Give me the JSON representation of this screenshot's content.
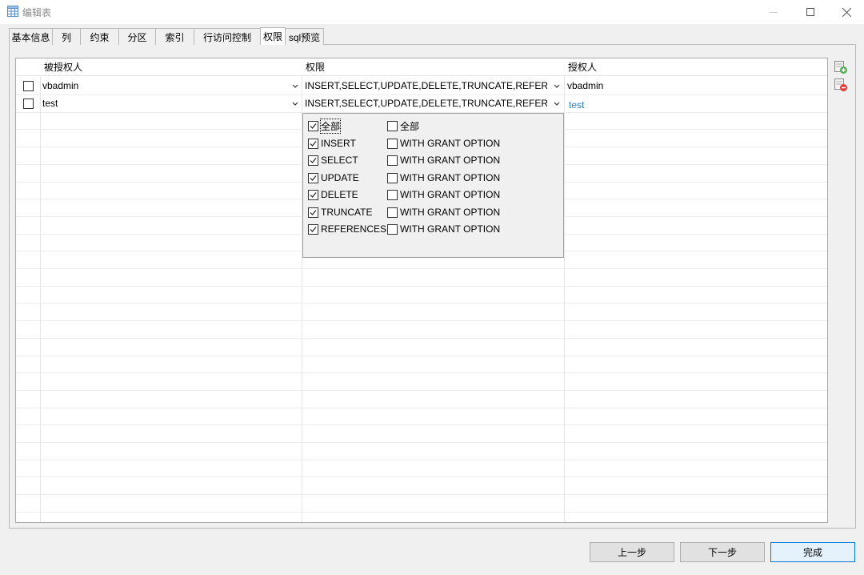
{
  "window": {
    "title": "编辑表",
    "icon": "table-icon"
  },
  "tabs": [
    {
      "label": "基本信息"
    },
    {
      "label": "列"
    },
    {
      "label": "约束"
    },
    {
      "label": "分区"
    },
    {
      "label": "索引"
    },
    {
      "label": "行访问控制"
    },
    {
      "label": "权限",
      "active": true
    },
    {
      "label": "sql预览"
    }
  ],
  "grid": {
    "columns": [
      "被授权人",
      "权限",
      "授权人"
    ],
    "rows": [
      {
        "grantee": "vbadmin",
        "privileges": "INSERT,SELECT,UPDATE,DELETE,TRUNCATE,REFERENCES",
        "grantor": "vbadmin",
        "checked": false
      },
      {
        "grantee": "test",
        "privileges": "INSERT,SELECT,UPDATE,DELETE,TRUNCATE,REFERENCES",
        "grantor": "test",
        "checked": false
      }
    ]
  },
  "privilege_dropdown": {
    "options": [
      {
        "label": "全部",
        "checked": true,
        "grant_label": "全部",
        "grant_checked": false
      },
      {
        "label": "INSERT",
        "checked": true,
        "grant_label": "WITH GRANT OPTION",
        "grant_checked": false
      },
      {
        "label": "SELECT",
        "checked": true,
        "grant_label": "WITH GRANT OPTION",
        "grant_checked": false
      },
      {
        "label": "UPDATE",
        "checked": true,
        "grant_label": "WITH GRANT OPTION",
        "grant_checked": false
      },
      {
        "label": "DELETE",
        "checked": true,
        "grant_label": "WITH GRANT OPTION",
        "grant_checked": false
      },
      {
        "label": "TRUNCATE",
        "checked": true,
        "grant_label": "WITH GRANT OPTION",
        "grant_checked": false
      },
      {
        "label": "REFERENCES",
        "checked": true,
        "grant_label": "WITH GRANT OPTION",
        "grant_checked": false
      }
    ]
  },
  "side_buttons": {
    "add_icon": "add-row-icon",
    "remove_icon": "remove-row-icon"
  },
  "footer": {
    "prev_label": "上一步",
    "next_label": "下一步",
    "finish_label": "完成"
  },
  "colors": {
    "grantor_link": "#2a7cbf",
    "primary_border": "#0078d7"
  }
}
